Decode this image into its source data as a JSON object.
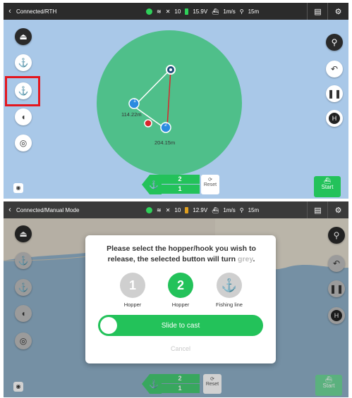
{
  "screen1": {
    "status": {
      "title": "Connected/RTH",
      "satellites": "10",
      "battery": "15.9V",
      "speed": "1m/s",
      "distance": "15m"
    },
    "map": {
      "point1_label": "1",
      "point2_label": "2",
      "dist1": "114.22m",
      "dist2": "204.15m"
    },
    "hook_panel": {
      "top_value": "2",
      "bottom_value": "1"
    },
    "reset_label": "Reset",
    "start_label": "Start"
  },
  "screen2": {
    "status": {
      "title": "Connected/Manual Mode",
      "satellites": "10",
      "battery": "12.9V",
      "speed": "1m/s",
      "distance": "15m"
    },
    "dialog": {
      "message_main": "Please select the hopper/hook you wish to release, the selected button will turn",
      "message_grey": "grey",
      "message_end": ".",
      "options": [
        {
          "number": "1",
          "label": "Hopper"
        },
        {
          "number": "2",
          "label": "Hopper"
        },
        {
          "number": "",
          "label": "Fishing line"
        }
      ],
      "slider_label": "Slide to cast",
      "cancel_label": "Cancel"
    },
    "hook_panel": {
      "top_value": "2",
      "bottom_value": "1"
    },
    "reset_label": "Reset",
    "start_label": "Start"
  },
  "colors": {
    "accent_green": "#23c25a",
    "highlight_red": "#e4161d",
    "map_blue": "#a9c8e8",
    "circle_green": "#4fbf8a"
  }
}
